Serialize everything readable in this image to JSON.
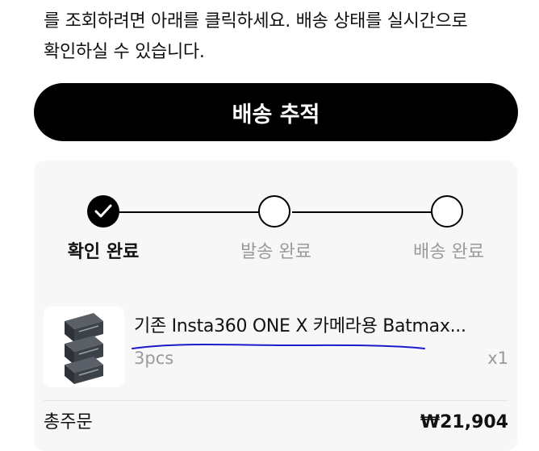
{
  "intro": {
    "line1": "를 조회하려면 아래를 클릭하세요. 배송 상태를 실시간으로",
    "line2": "확인하실 수 있습니다."
  },
  "track_button": {
    "label": "배송 추적"
  },
  "progress": {
    "steps": [
      {
        "label": "확인 완료",
        "status": "done"
      },
      {
        "label": "발송 완료",
        "status": "pending"
      },
      {
        "label": "배송 완료",
        "status": "pending"
      }
    ]
  },
  "order_item": {
    "name": "기존 Insta360 ONE X 카메라용 Batmax...",
    "variant": "3pcs",
    "quantity": "x1",
    "image_icon": "battery-pack-icon"
  },
  "summary": {
    "total_label": "총주문",
    "total_value": "₩21,904"
  },
  "colors": {
    "primary": "#000000",
    "card_bg": "#f7f7f7",
    "muted_text": "#9a9a9a",
    "annotation_underline": "#1a1acc"
  }
}
